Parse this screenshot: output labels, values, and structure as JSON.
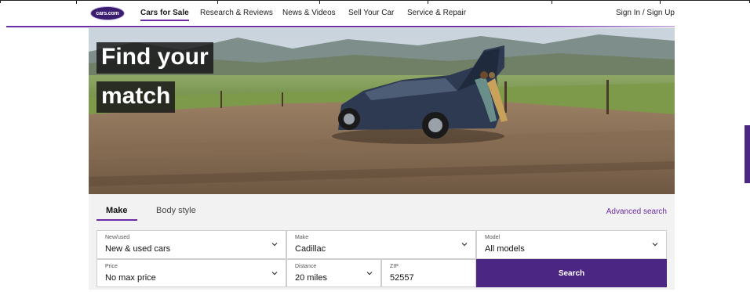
{
  "nav": {
    "logo_text": "cars.com",
    "items": [
      {
        "label": "Cars for Sale",
        "active": true
      },
      {
        "label": "Research & Reviews"
      },
      {
        "label": "News & Videos"
      },
      {
        "label": "Sell Your Car"
      },
      {
        "label": "Service & Repair"
      }
    ],
    "signin_label": "Sign In / Sign Up"
  },
  "hero": {
    "line1": "Find your",
    "line2": "match"
  },
  "search": {
    "tabs": [
      "Make",
      "Body style"
    ],
    "advanced_label": "Advanced search",
    "fields": {
      "new_used": {
        "label": "New/used",
        "value": "New & used cars"
      },
      "make": {
        "label": "Make",
        "value": "Cadillac"
      },
      "model": {
        "label": "Model",
        "value": "All models"
      },
      "price": {
        "label": "Price",
        "value": "No max price"
      },
      "distance": {
        "label": "Distance",
        "value": "20 miles"
      },
      "zip": {
        "label": "ZIP",
        "value": "52557"
      }
    },
    "search_label": "Search"
  },
  "colors": {
    "brand_purple": "#4c2683",
    "accent_purple": "#6a2ba3"
  }
}
